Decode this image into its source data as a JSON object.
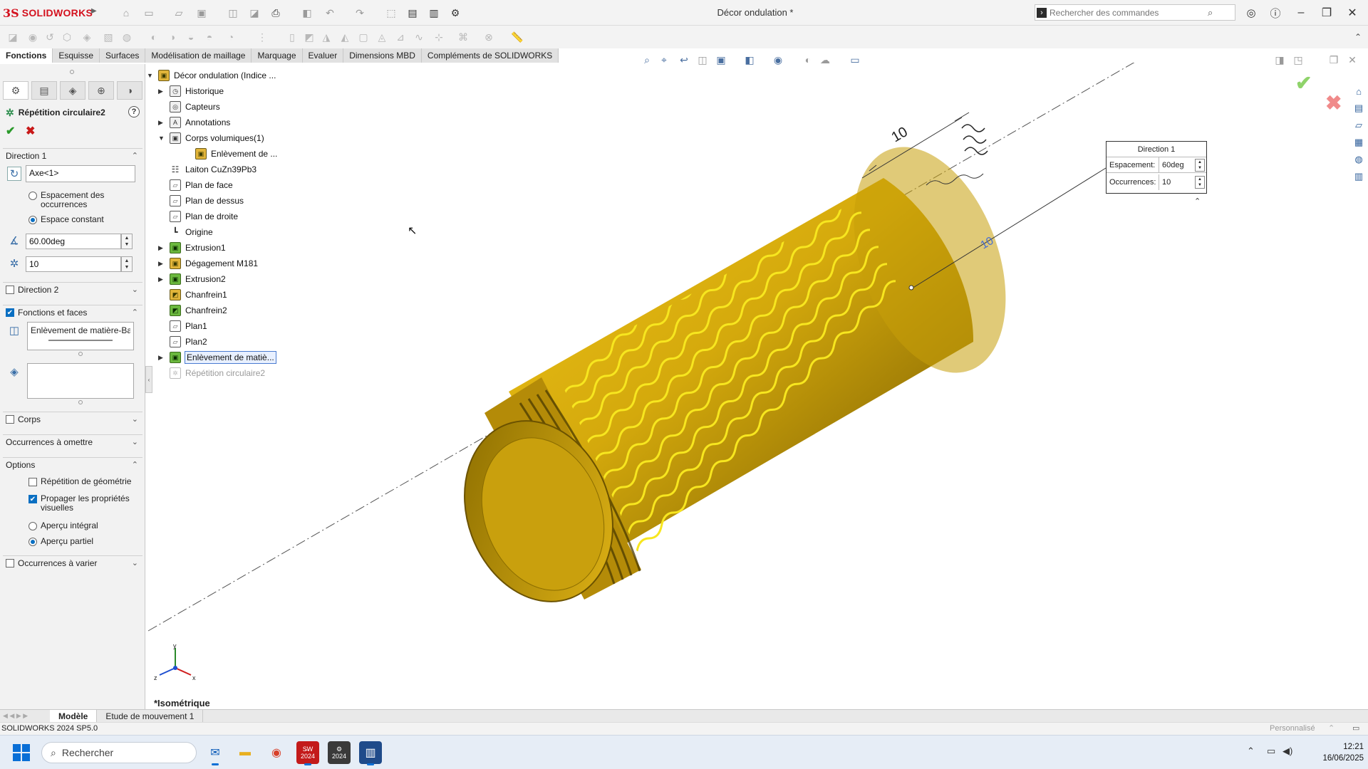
{
  "app": {
    "logo_mark": "3S",
    "logo_text": "SOLIDWORKS",
    "doc_title": "Décor ondulation *",
    "search_placeholder": "Rechercher des commandes"
  },
  "tabs": [
    {
      "label": "Fonctions",
      "active": true
    },
    {
      "label": "Esquisse"
    },
    {
      "label": "Surfaces"
    },
    {
      "label": "Modélisation de maillage"
    },
    {
      "label": "Marquage"
    },
    {
      "label": "Evaluer"
    },
    {
      "label": "Dimensions MBD"
    },
    {
      "label": "Compléments de SOLIDWORKS"
    }
  ],
  "property_manager": {
    "title": "Répétition circulaire2",
    "help": "?",
    "ok": "✔",
    "cancel": "✖",
    "direction1": {
      "label": "Direction 1",
      "axis": "Axe<1>",
      "radio_spacing": "Espacement des occurrences",
      "radio_constant": "Espace constant",
      "angle": "60.00deg",
      "count": "10"
    },
    "direction2": {
      "label": "Direction 2"
    },
    "features_faces": {
      "label": "Fonctions et faces",
      "features_item": "Enlèvement de matière-Bala"
    },
    "corps": {
      "label": "Corps"
    },
    "occurrences_omit": {
      "label": "Occurrences à omettre"
    },
    "options": {
      "label": "Options",
      "geom_repeat": "Répétition de géométrie",
      "propagate": "Propager les propriétés visuelles",
      "preview_full": "Aperçu intégral",
      "preview_partial": "Aperçu partiel"
    },
    "occurrences_vary": {
      "label": "Occurrences à varier"
    }
  },
  "tree": {
    "root": "Décor ondulation  (Indice ...",
    "items": [
      {
        "label": "Historique"
      },
      {
        "label": "Capteurs"
      },
      {
        "label": "Annotations"
      },
      {
        "label": "Corps volumiques(1)"
      },
      {
        "label": "Enlèvement de ..."
      },
      {
        "label": "Laiton CuZn39Pb3"
      },
      {
        "label": "Plan de face"
      },
      {
        "label": "Plan de dessus"
      },
      {
        "label": "Plan de droite"
      },
      {
        "label": "Origine"
      },
      {
        "label": "Extrusion1"
      },
      {
        "label": "Dégagement M181"
      },
      {
        "label": "Extrusion2"
      },
      {
        "label": "Chanfrein1"
      },
      {
        "label": "Chanfrein2"
      },
      {
        "label": "Plan1"
      },
      {
        "label": "Plan2"
      },
      {
        "label": "Enlèvement de matiè..."
      },
      {
        "label": "Répétition circulaire2"
      }
    ]
  },
  "callout": {
    "title": "Direction 1",
    "spacing_label": "Espacement:",
    "spacing_value": "60deg",
    "count_label": "Occurrences:",
    "count_value": "10"
  },
  "viewport": {
    "dim_top": "10",
    "dim_axis": "10",
    "view_name": "*Isométrique",
    "triad": {
      "x": "x",
      "y": "y",
      "z": "z"
    }
  },
  "bottom_tabs": [
    "Modèle",
    "Etude de mouvement 1"
  ],
  "status": {
    "version": "SOLIDWORKS 2024 SP5.0",
    "mode": "Personnalisé"
  },
  "taskbar": {
    "search": "Rechercher",
    "sw_badge_top": "S̶W",
    "sw_badge_year": "2024",
    "sw2_badge_year": "2024",
    "time": "12:21",
    "date": "16/06/2025"
  },
  "colors": {
    "accent": "#0a6fc2",
    "brand": "#d4111e",
    "part_gold": "#d4ab0c",
    "wave_yellow": "#f5e31a"
  }
}
